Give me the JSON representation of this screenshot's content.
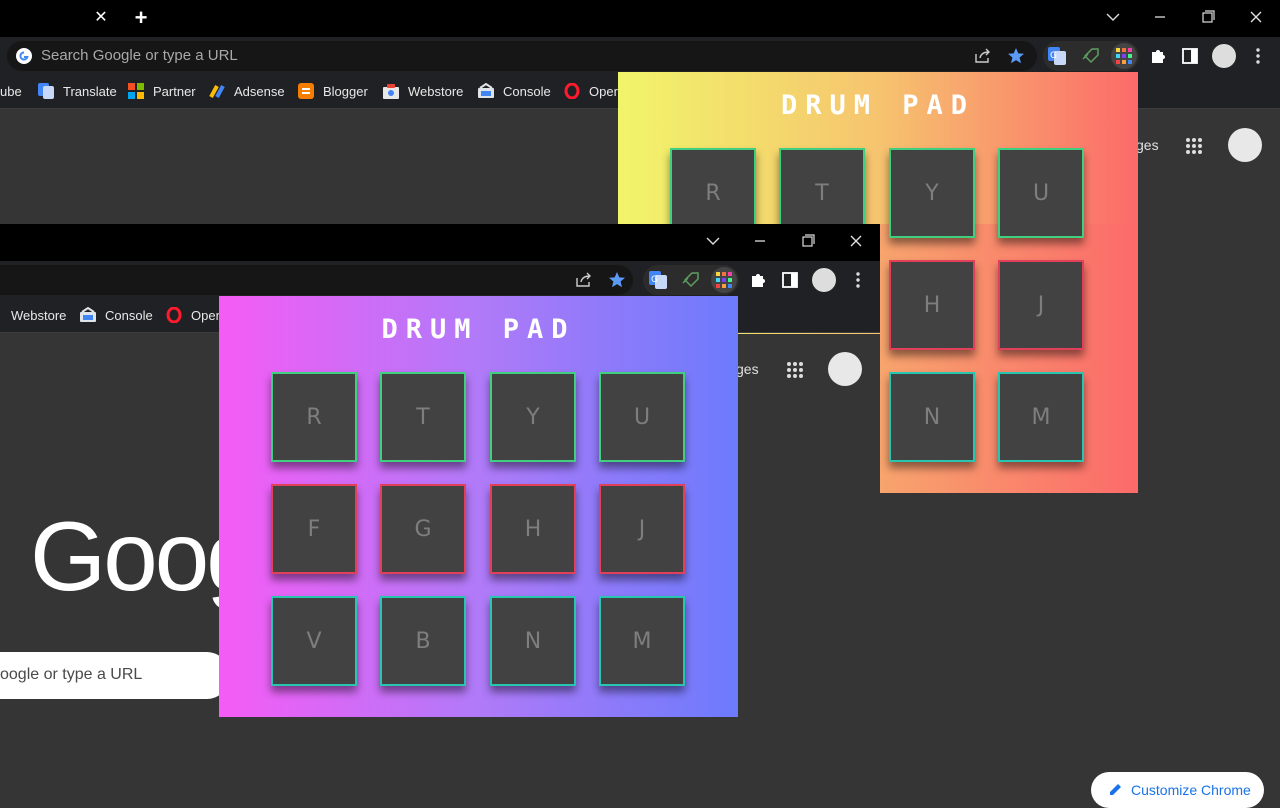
{
  "browser": {
    "omnibox_placeholder": "Search Google or type a URL",
    "tab_close": "✕",
    "new_tab": "+",
    "bookmarks": [
      "ube",
      "Translate",
      "Partner",
      "Adsense",
      "Blogger",
      "Webstore",
      "Console",
      "Opera"
    ],
    "front_bookmarks": [
      "Webstore",
      "Console",
      "Opera"
    ],
    "ntp_link": "ges",
    "customize_label": "Customize Chrome",
    "google_logo": "Goog",
    "ntp_search_placeholder": "oogle or type a URL"
  },
  "drum_pad_back": {
    "title": "DRUM PAD",
    "rows": [
      [
        "R",
        "T",
        "Y",
        "U"
      ],
      [
        "H",
        "J"
      ],
      [
        "N",
        "M"
      ]
    ]
  },
  "drum_pad_front": {
    "title": "DRUM PAD",
    "rows": [
      [
        "R",
        "T",
        "Y",
        "U"
      ],
      [
        "F",
        "G",
        "H",
        "J"
      ],
      [
        "V",
        "B",
        "N",
        "M"
      ]
    ]
  },
  "colors": {
    "back_gradient": [
      "#f1f56a",
      "#fc6a6a"
    ],
    "front_gradient": [
      "#f55cf5",
      "#6c7bfc"
    ],
    "pad_green": "#3fcf7f",
    "pad_red": "#e0405a",
    "pad_teal": "#28c6b0"
  }
}
